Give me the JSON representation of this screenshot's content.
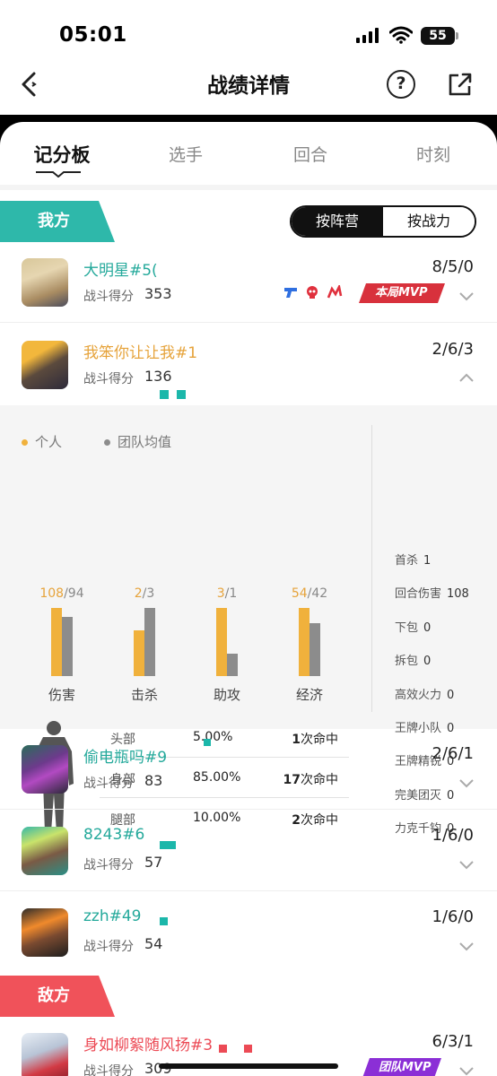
{
  "status": {
    "time": "05:01",
    "battery": "55"
  },
  "nav": {
    "title": "战绩详情"
  },
  "tabs": [
    {
      "label": "记分板"
    },
    {
      "label": "选手"
    },
    {
      "label": "回合"
    },
    {
      "label": "时刻"
    }
  ],
  "ally": {
    "label": "我方",
    "sort": {
      "by_team": "按阵营",
      "by_power": "按战力"
    },
    "players": [
      {
        "name": "大明星#5(",
        "score_label": "战斗得分",
        "score": "353",
        "kda": "8/5/0",
        "badge": "本局MVP"
      },
      {
        "name": "我笨你让让我#1",
        "score_label": "战斗得分",
        "score": "136",
        "kda": "2/6/3"
      },
      {
        "name": "偷电瓶吗#9",
        "score_label": "战斗得分",
        "score": "83",
        "kda": "2/6/1"
      },
      {
        "name": "8243#6",
        "score_label": "战斗得分",
        "score": "57",
        "kda": "1/6/0"
      },
      {
        "name": "zzh#49",
        "score_label": "战斗得分",
        "score": "54",
        "kda": "1/6/0"
      }
    ]
  },
  "detail": {
    "legend": {
      "personal": "个人",
      "team_avg": "团队均值"
    },
    "colors": {
      "personal": "#f0b13c",
      "team": "#8c8c8c"
    },
    "stats": [
      {
        "label": "首杀",
        "value": "1"
      },
      {
        "label": "回合伤害",
        "value": "108"
      },
      {
        "label": "下包",
        "value": "0"
      },
      {
        "label": "拆包",
        "value": "0"
      },
      {
        "label": "高效火力",
        "value": "0"
      },
      {
        "label": "王牌小队",
        "value": "0"
      },
      {
        "label": "王牌精锐",
        "value": "0"
      },
      {
        "label": "完美团灭",
        "value": "0"
      },
      {
        "label": "力克千钧",
        "value": "0"
      }
    ],
    "hits": [
      {
        "part": "头部",
        "pct": "5.00%",
        "count": "1",
        "unit": "次命中"
      },
      {
        "part": "身部",
        "pct": "85.00%",
        "count": "17",
        "unit": "次命中"
      },
      {
        "part": "腿部",
        "pct": "10.00%",
        "count": "2",
        "unit": "次命中"
      }
    ]
  },
  "chart_data": {
    "type": "bar",
    "categories": [
      "伤害",
      "击杀",
      "助攻",
      "经济"
    ],
    "series": [
      {
        "name": "个人",
        "values": [
          108,
          2,
          3,
          54
        ]
      },
      {
        "name": "团队均值",
        "values": [
          94,
          3,
          1,
          42
        ]
      }
    ]
  },
  "enemy": {
    "label": "敌方",
    "players": [
      {
        "name": "身如柳絮随风扬#3",
        "score_label": "战斗得分",
        "score": "309",
        "kda": "6/3/1",
        "badge": "团队MVP"
      }
    ]
  }
}
